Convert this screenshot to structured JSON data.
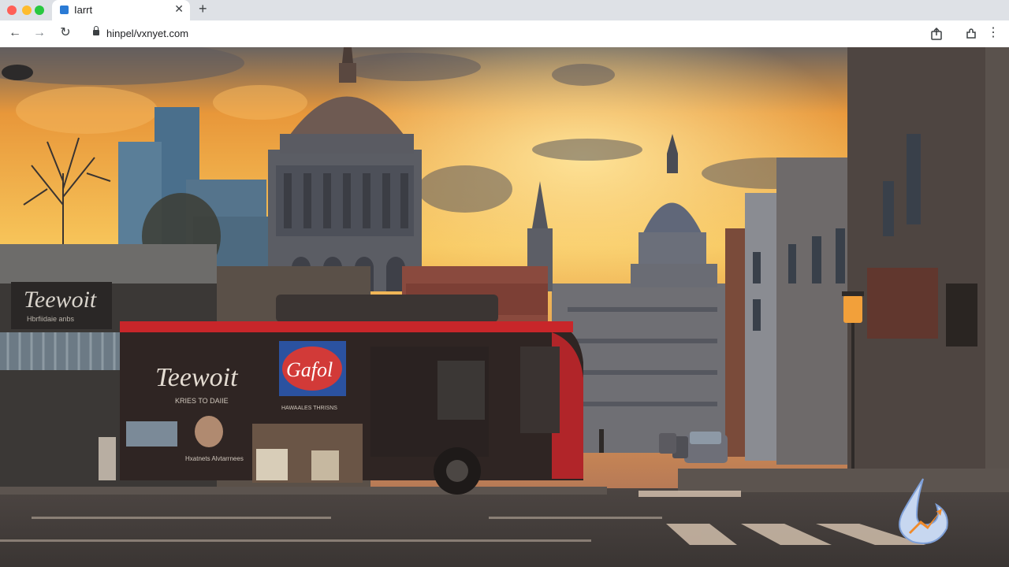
{
  "browser": {
    "tab_title": "Iarrt",
    "tab_close": "✕",
    "new_tab": "+",
    "url": "hinpel/vxnyet.com",
    "back": "←",
    "forward": "→",
    "reload": "↻",
    "menu": "⋮"
  },
  "scene": {
    "signs": {
      "shop_sign": "Teewoit",
      "shop_sign_sub": "Hbrfiidaie anbs",
      "bus_brand": "Teewoit",
      "bus_brand_sub": "KRIES TO DAIIE",
      "bus_logo": "Gafol",
      "bus_ad_line": "HAWAALES THRISNS",
      "bus_ad_footer": "Hxatnets Alvtarrnees"
    }
  },
  "colors": {
    "sky_top": "#5a5f66",
    "sunset": "#f2a23a",
    "bus_red": "#c8262a",
    "chrome_bg": "#ffffff"
  }
}
